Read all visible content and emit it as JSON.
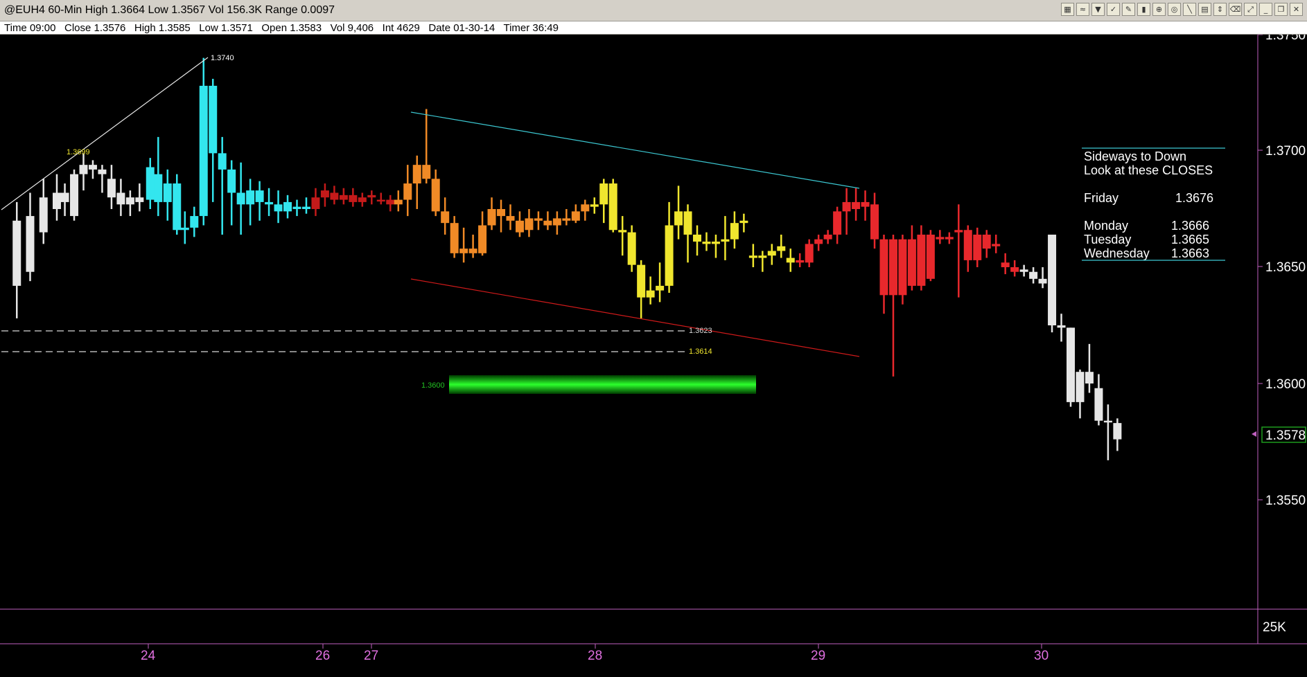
{
  "window": {
    "title": "@EUH4 60-Min High 1.3664 Low 1.3567 Vol 156.3K Range 0.0097"
  },
  "toolbar": {
    "buttons": [
      {
        "icon": "chart-icon",
        "glyph": "▦"
      },
      {
        "icon": "indicator-icon",
        "glyph": "≈"
      },
      {
        "icon": "filter-icon",
        "glyph": "▼"
      },
      {
        "icon": "check-icon",
        "glyph": "✓"
      },
      {
        "icon": "pencil-icon",
        "glyph": "✎"
      },
      {
        "icon": "bars-icon",
        "glyph": "▮"
      },
      {
        "icon": "alarm-icon",
        "glyph": "⊕"
      },
      {
        "icon": "target-icon",
        "glyph": "◎"
      },
      {
        "icon": "draw-icon",
        "glyph": "╲"
      },
      {
        "icon": "doc-icon",
        "glyph": "▤"
      },
      {
        "icon": "up-down-icon",
        "glyph": "⇕"
      },
      {
        "icon": "trash-icon",
        "glyph": "⌫"
      },
      {
        "icon": "zoom-icon",
        "glyph": "⤢"
      },
      {
        "icon": "minimize-icon",
        "glyph": "_"
      },
      {
        "icon": "restore-icon",
        "glyph": "❐"
      },
      {
        "icon": "close-icon",
        "glyph": "✕"
      }
    ]
  },
  "infobar": {
    "text": "Time 09:00   Close 1.3576   High 1.3585   Low 1.3571   Open 1.3583   Vol 9,406   Int 4629   Date 01-30-14   Timer 36:49"
  },
  "price_axis": {
    "labels": [
      "1.3750",
      "1.3700",
      "1.3650",
      "1.3600",
      "1.3550"
    ],
    "current_price": "1.3578",
    "volume_label": "25K"
  },
  "date_axis": {
    "labels": [
      "24",
      "26",
      "27",
      "28",
      "29",
      "30"
    ]
  },
  "annotations": {
    "peak_label": "1.3740",
    "swing_label": "1.3699",
    "level_1": "1.3623",
    "level_2": "1.3614",
    "zone_label": "1.3600"
  },
  "notes": {
    "line1": "Sideways to Down",
    "line2": "Look at these CLOSES",
    "rows": [
      {
        "day": "Friday",
        "value": "1.3676"
      },
      {
        "day": "Monday",
        "value": "1.3666"
      },
      {
        "day": "Tuesday",
        "value": "1.3665"
      },
      {
        "day": "Wednesday",
        "value": "1.3663"
      }
    ]
  },
  "colors": {
    "cyan": "#33e6ee",
    "darkred": "#c41a1a",
    "orange": "#f08a26",
    "yellow": "#f0e62e",
    "red": "#e8282c",
    "white": "#e6e6e6",
    "zone": "#1bdc1b",
    "axis": "#c060c0"
  },
  "chart_data": {
    "type": "candlestick",
    "ylim": [
      1.3547,
      1.3752
    ],
    "candles": [
      {
        "x": 1.0,
        "o": 1.3642,
        "h": 1.3678,
        "l": 1.3628,
        "c": 1.367,
        "g": "white"
      },
      {
        "x": 2.0,
        "o": 1.3648,
        "h": 1.3682,
        "l": 1.3644,
        "c": 1.3672,
        "g": "white"
      },
      {
        "x": 3.0,
        "o": 1.3665,
        "h": 1.3688,
        "l": 1.366,
        "c": 1.368,
        "g": "white"
      },
      {
        "x": 4.0,
        "o": 1.3675,
        "h": 1.369,
        "l": 1.367,
        "c": 1.3682,
        "g": "white"
      },
      {
        "x": 4.6,
        "o": 1.3678,
        "h": 1.3686,
        "l": 1.3672,
        "c": 1.3682,
        "g": "white"
      },
      {
        "x": 5.3,
        "o": 1.3672,
        "h": 1.3692,
        "l": 1.367,
        "c": 1.369,
        "g": "white"
      },
      {
        "x": 6.0,
        "o": 1.369,
        "h": 1.3699,
        "l": 1.3683,
        "c": 1.3694,
        "g": "white"
      },
      {
        "x": 6.7,
        "o": 1.3694,
        "h": 1.3696,
        "l": 1.3688,
        "c": 1.3692,
        "g": "white"
      },
      {
        "x": 7.4,
        "o": 1.3692,
        "h": 1.3694,
        "l": 1.3682,
        "c": 1.369,
        "g": "white"
      },
      {
        "x": 8.1,
        "o": 1.3688,
        "h": 1.3694,
        "l": 1.3675,
        "c": 1.368,
        "g": "white"
      },
      {
        "x": 8.8,
        "o": 1.3682,
        "h": 1.3688,
        "l": 1.3672,
        "c": 1.3677,
        "g": "white"
      },
      {
        "x": 9.5,
        "o": 1.3677,
        "h": 1.3683,
        "l": 1.3672,
        "c": 1.368,
        "g": "white"
      },
      {
        "x": 10.2,
        "o": 1.368,
        "h": 1.3686,
        "l": 1.3674,
        "c": 1.3678,
        "g": "white"
      },
      {
        "x": 11.0,
        "o": 1.3679,
        "h": 1.3697,
        "l": 1.3675,
        "c": 1.3693,
        "g": "cyan"
      },
      {
        "x": 11.6,
        "o": 1.369,
        "h": 1.3706,
        "l": 1.3672,
        "c": 1.3678,
        "g": "cyan"
      },
      {
        "x": 12.3,
        "o": 1.3678,
        "h": 1.3692,
        "l": 1.367,
        "c": 1.3686,
        "g": "cyan"
      },
      {
        "x": 13.0,
        "o": 1.3686,
        "h": 1.369,
        "l": 1.3664,
        "c": 1.3666,
        "g": "cyan"
      },
      {
        "x": 13.6,
        "o": 1.3666,
        "h": 1.3674,
        "l": 1.366,
        "c": 1.3667,
        "g": "cyan"
      },
      {
        "x": 14.3,
        "o": 1.3667,
        "h": 1.3676,
        "l": 1.3663,
        "c": 1.3672,
        "g": "cyan"
      },
      {
        "x": 15.0,
        "o": 1.3672,
        "h": 1.374,
        "l": 1.3668,
        "c": 1.3728,
        "g": "cyan"
      },
      {
        "x": 15.7,
        "o": 1.3728,
        "h": 1.3731,
        "l": 1.3678,
        "c": 1.3699,
        "g": "cyan"
      },
      {
        "x": 16.4,
        "o": 1.3699,
        "h": 1.3706,
        "l": 1.3664,
        "c": 1.3692,
        "g": "cyan"
      },
      {
        "x": 17.1,
        "o": 1.3692,
        "h": 1.3696,
        "l": 1.3668,
        "c": 1.3682,
        "g": "cyan"
      },
      {
        "x": 17.8,
        "o": 1.3682,
        "h": 1.3695,
        "l": 1.3664,
        "c": 1.3677,
        "g": "cyan"
      },
      {
        "x": 18.5,
        "o": 1.3677,
        "h": 1.3688,
        "l": 1.3668,
        "c": 1.3683,
        "g": "cyan"
      },
      {
        "x": 19.2,
        "o": 1.3683,
        "h": 1.3687,
        "l": 1.367,
        "c": 1.3678,
        "g": "cyan"
      },
      {
        "x": 19.9,
        "o": 1.3678,
        "h": 1.3684,
        "l": 1.3672,
        "c": 1.3677,
        "g": "cyan"
      },
      {
        "x": 20.6,
        "o": 1.3677,
        "h": 1.3683,
        "l": 1.3669,
        "c": 1.3674,
        "g": "cyan"
      },
      {
        "x": 21.3,
        "o": 1.3674,
        "h": 1.3681,
        "l": 1.3671,
        "c": 1.3678,
        "g": "cyan"
      },
      {
        "x": 22.0,
        "o": 1.3676,
        "h": 1.3679,
        "l": 1.3672,
        "c": 1.3675,
        "g": "cyan"
      },
      {
        "x": 22.7,
        "o": 1.3675,
        "h": 1.368,
        "l": 1.3673,
        "c": 1.3676,
        "g": "cyan"
      },
      {
        "x": 23.4,
        "o": 1.3675,
        "h": 1.3684,
        "l": 1.3672,
        "c": 1.368,
        "g": "darkred"
      },
      {
        "x": 24.1,
        "o": 1.368,
        "h": 1.3686,
        "l": 1.3676,
        "c": 1.3683,
        "g": "darkred"
      },
      {
        "x": 24.8,
        "o": 1.3682,
        "h": 1.3685,
        "l": 1.3677,
        "c": 1.3679,
        "g": "darkred"
      },
      {
        "x": 25.5,
        "o": 1.3679,
        "h": 1.3684,
        "l": 1.3677,
        "c": 1.3681,
        "g": "darkred"
      },
      {
        "x": 26.2,
        "o": 1.3681,
        "h": 1.3684,
        "l": 1.3676,
        "c": 1.3678,
        "g": "darkred"
      },
      {
        "x": 26.9,
        "o": 1.3678,
        "h": 1.3682,
        "l": 1.3676,
        "c": 1.368,
        "g": "darkred"
      },
      {
        "x": 27.6,
        "o": 1.368,
        "h": 1.3683,
        "l": 1.3677,
        "c": 1.3681,
        "g": "darkred"
      },
      {
        "x": 28.3,
        "o": 1.3679,
        "h": 1.3682,
        "l": 1.3677,
        "c": 1.3679,
        "g": "darkred"
      },
      {
        "x": 29.0,
        "o": 1.3679,
        "h": 1.3681,
        "l": 1.3674,
        "c": 1.3677,
        "g": "darkred"
      },
      {
        "x": 29.6,
        "o": 1.3677,
        "h": 1.3683,
        "l": 1.3674,
        "c": 1.3679,
        "g": "orange"
      },
      {
        "x": 30.3,
        "o": 1.3679,
        "h": 1.3694,
        "l": 1.3672,
        "c": 1.3686,
        "g": "orange"
      },
      {
        "x": 31.0,
        "o": 1.3686,
        "h": 1.3698,
        "l": 1.3675,
        "c": 1.3694,
        "g": "orange"
      },
      {
        "x": 31.7,
        "o": 1.3694,
        "h": 1.3718,
        "l": 1.3686,
        "c": 1.3688,
        "g": "orange"
      },
      {
        "x": 32.4,
        "o": 1.3688,
        "h": 1.3692,
        "l": 1.3672,
        "c": 1.3674,
        "g": "orange"
      },
      {
        "x": 33.1,
        "o": 1.3674,
        "h": 1.368,
        "l": 1.3664,
        "c": 1.3669,
        "g": "orange"
      },
      {
        "x": 33.8,
        "o": 1.3669,
        "h": 1.3672,
        "l": 1.3654,
        "c": 1.3656,
        "g": "orange"
      },
      {
        "x": 34.5,
        "o": 1.3656,
        "h": 1.3667,
        "l": 1.3652,
        "c": 1.3658,
        "g": "orange"
      },
      {
        "x": 35.2,
        "o": 1.3658,
        "h": 1.3664,
        "l": 1.3654,
        "c": 1.3656,
        "g": "orange"
      },
      {
        "x": 35.9,
        "o": 1.3656,
        "h": 1.3674,
        "l": 1.3655,
        "c": 1.3668,
        "g": "orange"
      },
      {
        "x": 36.6,
        "o": 1.3668,
        "h": 1.368,
        "l": 1.3666,
        "c": 1.3675,
        "g": "orange"
      },
      {
        "x": 37.3,
        "o": 1.3675,
        "h": 1.3679,
        "l": 1.3665,
        "c": 1.3672,
        "g": "orange"
      },
      {
        "x": 38.0,
        "o": 1.3672,
        "h": 1.3677,
        "l": 1.3666,
        "c": 1.367,
        "g": "orange"
      },
      {
        "x": 38.7,
        "o": 1.367,
        "h": 1.3674,
        "l": 1.3663,
        "c": 1.3665,
        "g": "orange"
      },
      {
        "x": 39.4,
        "o": 1.3666,
        "h": 1.3675,
        "l": 1.3663,
        "c": 1.3671,
        "g": "orange"
      },
      {
        "x": 40.1,
        "o": 1.3671,
        "h": 1.3674,
        "l": 1.3666,
        "c": 1.367,
        "g": "orange"
      },
      {
        "x": 40.8,
        "o": 1.367,
        "h": 1.3674,
        "l": 1.3666,
        "c": 1.3668,
        "g": "orange"
      },
      {
        "x": 41.5,
        "o": 1.3668,
        "h": 1.3674,
        "l": 1.3664,
        "c": 1.3671,
        "g": "orange"
      },
      {
        "x": 42.2,
        "o": 1.3671,
        "h": 1.3675,
        "l": 1.3668,
        "c": 1.367,
        "g": "orange"
      },
      {
        "x": 42.9,
        "o": 1.367,
        "h": 1.3677,
        "l": 1.3669,
        "c": 1.3674,
        "g": "orange"
      },
      {
        "x": 43.6,
        "o": 1.3674,
        "h": 1.3679,
        "l": 1.367,
        "c": 1.3677,
        "g": "orange"
      },
      {
        "x": 44.3,
        "o": 1.3676,
        "h": 1.368,
        "l": 1.3673,
        "c": 1.3677,
        "g": "yellow"
      },
      {
        "x": 45.0,
        "o": 1.3677,
        "h": 1.3688,
        "l": 1.3669,
        "c": 1.3686,
        "g": "yellow"
      },
      {
        "x": 45.7,
        "o": 1.3686,
        "h": 1.3688,
        "l": 1.3665,
        "c": 1.3666,
        "g": "yellow"
      },
      {
        "x": 46.4,
        "o": 1.3666,
        "h": 1.3672,
        "l": 1.3655,
        "c": 1.3665,
        "g": "yellow"
      },
      {
        "x": 47.1,
        "o": 1.3665,
        "h": 1.3668,
        "l": 1.3648,
        "c": 1.3651,
        "g": "yellow"
      },
      {
        "x": 47.8,
        "o": 1.3651,
        "h": 1.3653,
        "l": 1.3628,
        "c": 1.3637,
        "g": "yellow"
      },
      {
        "x": 48.5,
        "o": 1.3637,
        "h": 1.3646,
        "l": 1.3634,
        "c": 1.364,
        "g": "yellow"
      },
      {
        "x": 49.2,
        "o": 1.364,
        "h": 1.3652,
        "l": 1.3635,
        "c": 1.3642,
        "g": "yellow"
      },
      {
        "x": 49.9,
        "o": 1.3642,
        "h": 1.3678,
        "l": 1.3639,
        "c": 1.3668,
        "g": "yellow"
      },
      {
        "x": 50.6,
        "o": 1.3668,
        "h": 1.3685,
        "l": 1.3662,
        "c": 1.3674,
        "g": "yellow"
      },
      {
        "x": 51.3,
        "o": 1.3674,
        "h": 1.3677,
        "l": 1.3652,
        "c": 1.3664,
        "g": "yellow"
      },
      {
        "x": 52.0,
        "o": 1.3664,
        "h": 1.3668,
        "l": 1.3655,
        "c": 1.3661,
        "g": "yellow"
      },
      {
        "x": 52.7,
        "o": 1.3661,
        "h": 1.3665,
        "l": 1.3657,
        "c": 1.366,
        "g": "yellow"
      },
      {
        "x": 53.4,
        "o": 1.366,
        "h": 1.3664,
        "l": 1.3654,
        "c": 1.3661,
        "g": "yellow"
      },
      {
        "x": 54.1,
        "o": 1.3661,
        "h": 1.3672,
        "l": 1.3653,
        "c": 1.3662,
        "g": "yellow"
      },
      {
        "x": 54.8,
        "o": 1.3662,
        "h": 1.3674,
        "l": 1.3658,
        "c": 1.3669,
        "g": "yellow"
      },
      {
        "x": 55.5,
        "o": 1.3669,
        "h": 1.3673,
        "l": 1.3665,
        "c": 1.367,
        "g": "yellow"
      },
      {
        "x": 56.2,
        "o": 1.3655,
        "h": 1.366,
        "l": 1.365,
        "c": 1.3654,
        "g": "yellow"
      },
      {
        "x": 56.9,
        "o": 1.3654,
        "h": 1.3657,
        "l": 1.3648,
        "c": 1.3655,
        "g": "yellow"
      },
      {
        "x": 57.6,
        "o": 1.3655,
        "h": 1.366,
        "l": 1.3651,
        "c": 1.3657,
        "g": "yellow"
      },
      {
        "x": 58.3,
        "o": 1.3657,
        "h": 1.3664,
        "l": 1.3654,
        "c": 1.3659,
        "g": "yellow"
      },
      {
        "x": 59.0,
        "o": 1.3652,
        "h": 1.3658,
        "l": 1.3648,
        "c": 1.3654,
        "g": "yellow"
      },
      {
        "x": 59.7,
        "o": 1.3652,
        "h": 1.3656,
        "l": 1.365,
        "c": 1.3653,
        "g": "red"
      },
      {
        "x": 60.4,
        "o": 1.3652,
        "h": 1.3662,
        "l": 1.365,
        "c": 1.366,
        "g": "red"
      },
      {
        "x": 61.1,
        "o": 1.366,
        "h": 1.3664,
        "l": 1.3657,
        "c": 1.3662,
        "g": "red"
      },
      {
        "x": 61.8,
        "o": 1.3662,
        "h": 1.3666,
        "l": 1.366,
        "c": 1.3664,
        "g": "red"
      },
      {
        "x": 62.5,
        "o": 1.3664,
        "h": 1.3676,
        "l": 1.366,
        "c": 1.3674,
        "g": "red"
      },
      {
        "x": 63.2,
        "o": 1.3674,
        "h": 1.3684,
        "l": 1.3664,
        "c": 1.3678,
        "g": "red"
      },
      {
        "x": 63.9,
        "o": 1.3678,
        "h": 1.3684,
        "l": 1.367,
        "c": 1.3675,
        "g": "red"
      },
      {
        "x": 64.6,
        "o": 1.3676,
        "h": 1.3683,
        "l": 1.367,
        "c": 1.3678,
        "g": "red"
      },
      {
        "x": 65.3,
        "o": 1.3677,
        "h": 1.3682,
        "l": 1.3658,
        "c": 1.3662,
        "g": "red"
      },
      {
        "x": 66.0,
        "o": 1.3662,
        "h": 1.3664,
        "l": 1.363,
        "c": 1.3638,
        "g": "red"
      },
      {
        "x": 66.7,
        "o": 1.3662,
        "h": 1.3664,
        "l": 1.3603,
        "c": 1.3638,
        "g": "red"
      },
      {
        "x": 67.4,
        "o": 1.3638,
        "h": 1.3664,
        "l": 1.3634,
        "c": 1.3662,
        "g": "red"
      },
      {
        "x": 68.1,
        "o": 1.3662,
        "h": 1.3668,
        "l": 1.364,
        "c": 1.3642,
        "g": "red"
      },
      {
        "x": 68.8,
        "o": 1.3642,
        "h": 1.3668,
        "l": 1.364,
        "c": 1.3664,
        "g": "red"
      },
      {
        "x": 69.5,
        "o": 1.3664,
        "h": 1.3666,
        "l": 1.3644,
        "c": 1.3645,
        "g": "red"
      },
      {
        "x": 70.2,
        "o": 1.3663,
        "h": 1.3666,
        "l": 1.366,
        "c": 1.3662,
        "g": "red"
      },
      {
        "x": 70.9,
        "o": 1.3662,
        "h": 1.3665,
        "l": 1.366,
        "c": 1.3663,
        "g": "red"
      },
      {
        "x": 71.6,
        "o": 1.3665,
        "h": 1.3677,
        "l": 1.3637,
        "c": 1.3666,
        "g": "red"
      },
      {
        "x": 72.3,
        "o": 1.3666,
        "h": 1.3668,
        "l": 1.3648,
        "c": 1.3653,
        "g": "red"
      },
      {
        "x": 73.0,
        "o": 1.3653,
        "h": 1.3667,
        "l": 1.365,
        "c": 1.3664,
        "g": "red"
      },
      {
        "x": 73.7,
        "o": 1.3664,
        "h": 1.3666,
        "l": 1.3654,
        "c": 1.3658,
        "g": "red"
      },
      {
        "x": 74.4,
        "o": 1.366,
        "h": 1.3664,
        "l": 1.3656,
        "c": 1.3659,
        "g": "red"
      },
      {
        "x": 75.1,
        "o": 1.3652,
        "h": 1.3656,
        "l": 1.3647,
        "c": 1.365,
        "g": "red"
      },
      {
        "x": 75.8,
        "o": 1.365,
        "h": 1.3653,
        "l": 1.3646,
        "c": 1.3648,
        "g": "red"
      },
      {
        "x": 76.5,
        "o": 1.3649,
        "h": 1.3651,
        "l": 1.3646,
        "c": 1.3648,
        "g": "white"
      },
      {
        "x": 77.2,
        "o": 1.3648,
        "h": 1.365,
        "l": 1.3643,
        "c": 1.3645,
        "g": "white"
      },
      {
        "x": 77.9,
        "o": 1.3645,
        "h": 1.365,
        "l": 1.3641,
        "c": 1.3643,
        "g": "white"
      },
      {
        "x": 78.6,
        "o": 1.3664,
        "h": 1.3664,
        "l": 1.3622,
        "c": 1.3625,
        "g": "white"
      },
      {
        "x": 79.3,
        "o": 1.3625,
        "h": 1.363,
        "l": 1.3618,
        "c": 1.3624,
        "g": "white"
      },
      {
        "x": 80.0,
        "o": 1.3624,
        "h": 1.3624,
        "l": 1.359,
        "c": 1.3592,
        "g": "white"
      },
      {
        "x": 80.7,
        "o": 1.3605,
        "h": 1.3606,
        "l": 1.3585,
        "c": 1.3592,
        "g": "white"
      },
      {
        "x": 81.4,
        "o": 1.3605,
        "h": 1.3617,
        "l": 1.3596,
        "c": 1.36,
        "g": "white"
      },
      {
        "x": 82.1,
        "o": 1.3598,
        "h": 1.3604,
        "l": 1.3582,
        "c": 1.3584,
        "g": "white"
      },
      {
        "x": 82.8,
        "o": 1.3584,
        "h": 1.3591,
        "l": 1.3567,
        "c": 1.3584,
        "g": "white"
      },
      {
        "x": 83.5,
        "o": 1.3583,
        "h": 1.3585,
        "l": 1.3571,
        "c": 1.3576,
        "g": "white"
      }
    ]
  }
}
